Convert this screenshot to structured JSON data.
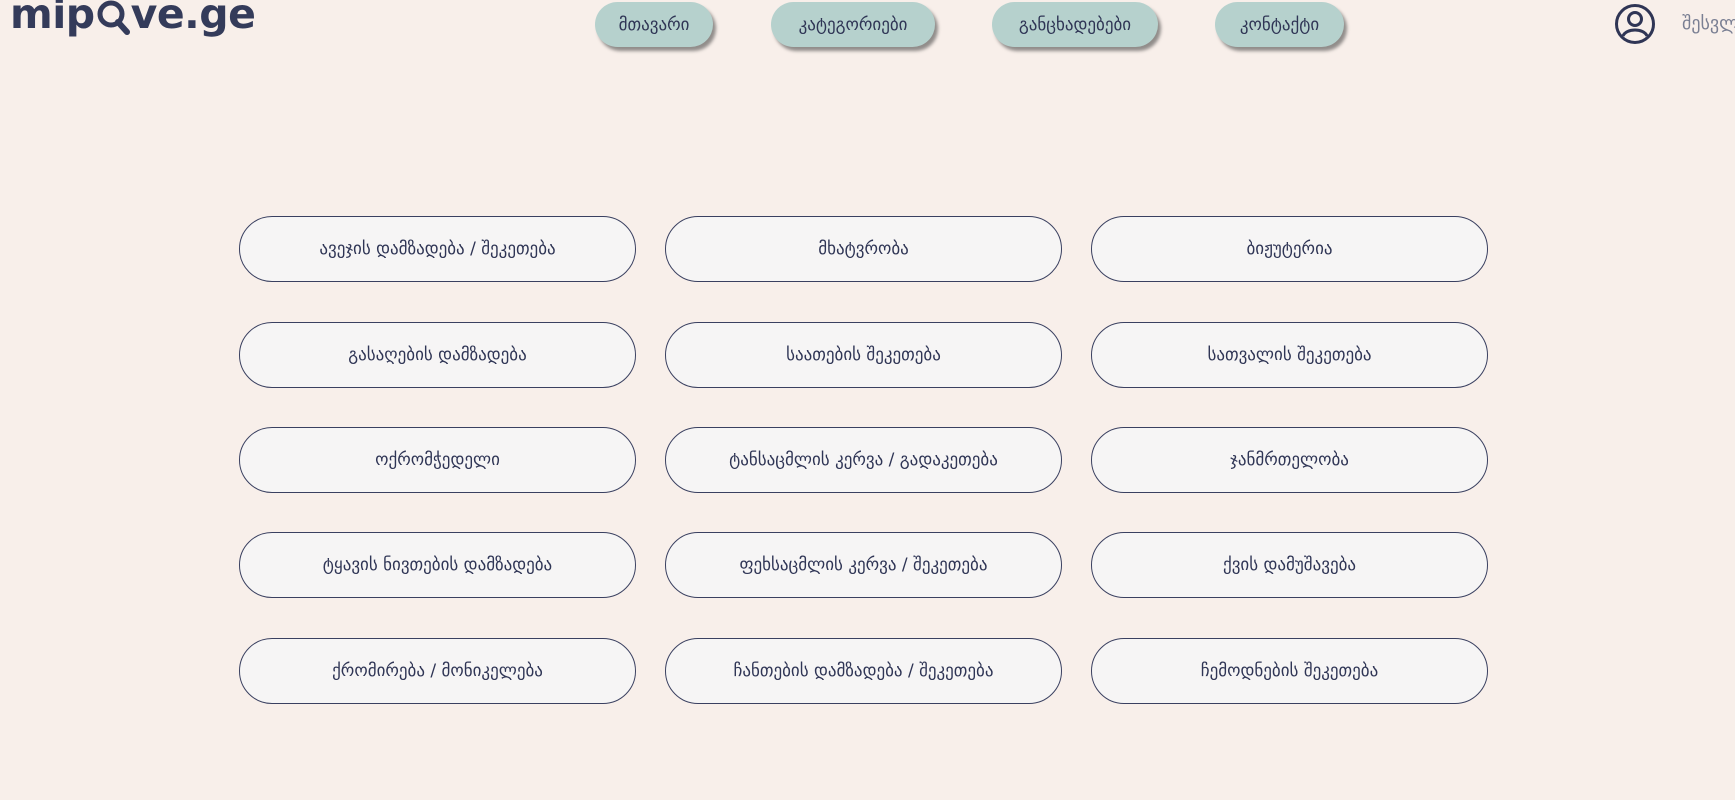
{
  "header": {
    "logo_left": "mip",
    "logo_right": "ve.ge",
    "nav": [
      {
        "label": "მთავარი"
      },
      {
        "label": "კატეგორიები"
      },
      {
        "label": "განცხადებები"
      },
      {
        "label": "კონტაქტი"
      }
    ],
    "login_label": "შესვლ"
  },
  "colors": {
    "background": "#f8efea",
    "nav_pill": "#b6d1cd",
    "text": "#2f3555",
    "button_bg": "#f6f5f5"
  },
  "categories": [
    {
      "label": "ავეჯის დამზადება / შეკეთება"
    },
    {
      "label": "მხატვრობა"
    },
    {
      "label": "ბიჟუტერია"
    },
    {
      "label": "გასაღების დამზადება"
    },
    {
      "label": "საათების შეკეთება"
    },
    {
      "label": "სათვალის შეკეთება"
    },
    {
      "label": "ოქრომჭედელი"
    },
    {
      "label": "ტანსაცმლის კერვა / გადაკეთება"
    },
    {
      "label": "ჯანმრთელობა"
    },
    {
      "label": "ტყავის ნივთების დამზადება"
    },
    {
      "label": "ფეხსაცმლის კერვა / შეკეთება"
    },
    {
      "label": "ქვის დამუშავება"
    },
    {
      "label": "ქრომირება / მონიკელება"
    },
    {
      "label": "ჩანთების დამზადება / შეკეთება"
    },
    {
      "label": "ჩემოდნების შეკეთება"
    }
  ]
}
